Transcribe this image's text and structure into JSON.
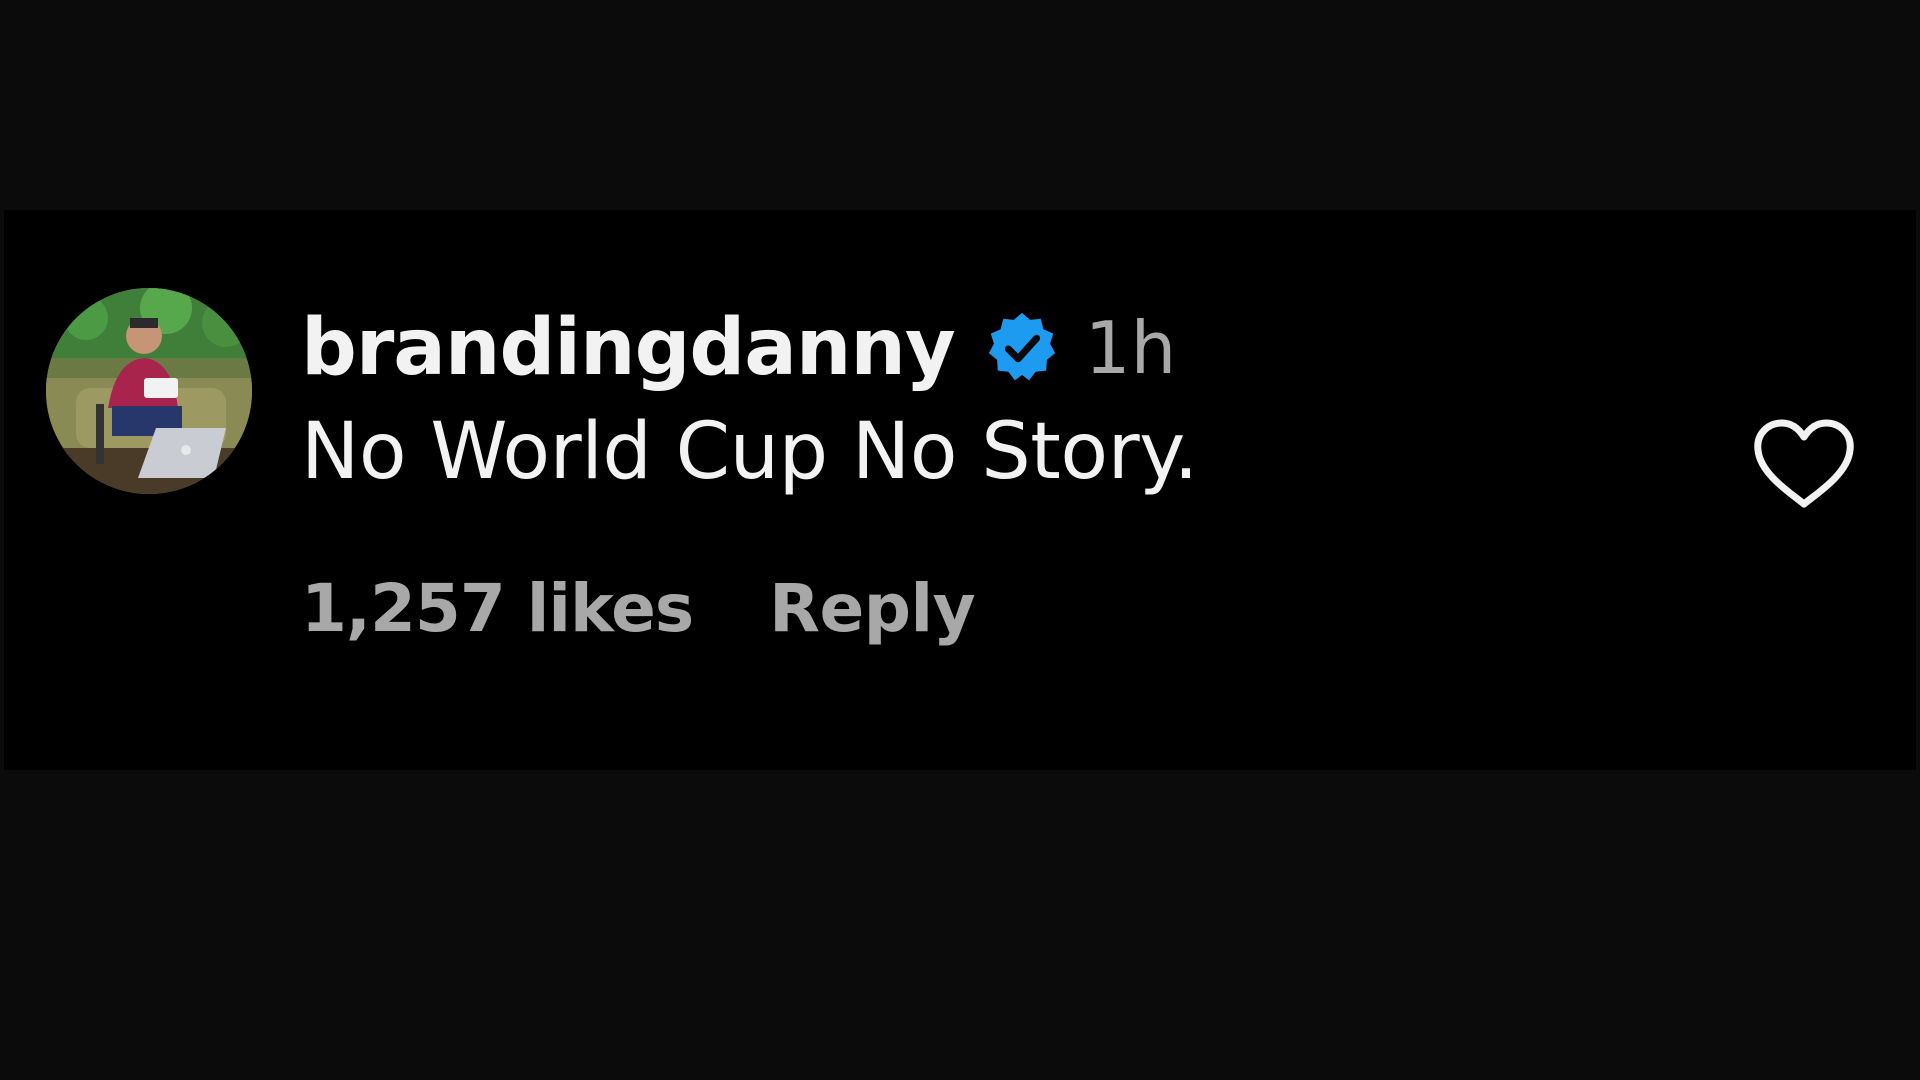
{
  "comment": {
    "username": "brandingdanny",
    "verified": true,
    "timestamp": "1h",
    "text": "No World Cup No Story.",
    "likes": "1,257 likes",
    "reply_label": "Reply"
  },
  "icons": {
    "avatar": "profile-photo",
    "verified": "verified-badge-icon",
    "like": "heart-outline-icon"
  },
  "colors": {
    "background": "#000000",
    "outer_background": "#0b0b0b",
    "primary_text": "#f2f2f2",
    "secondary_text": "#a8a8a8",
    "verified_blue": "#1d9bf0"
  }
}
